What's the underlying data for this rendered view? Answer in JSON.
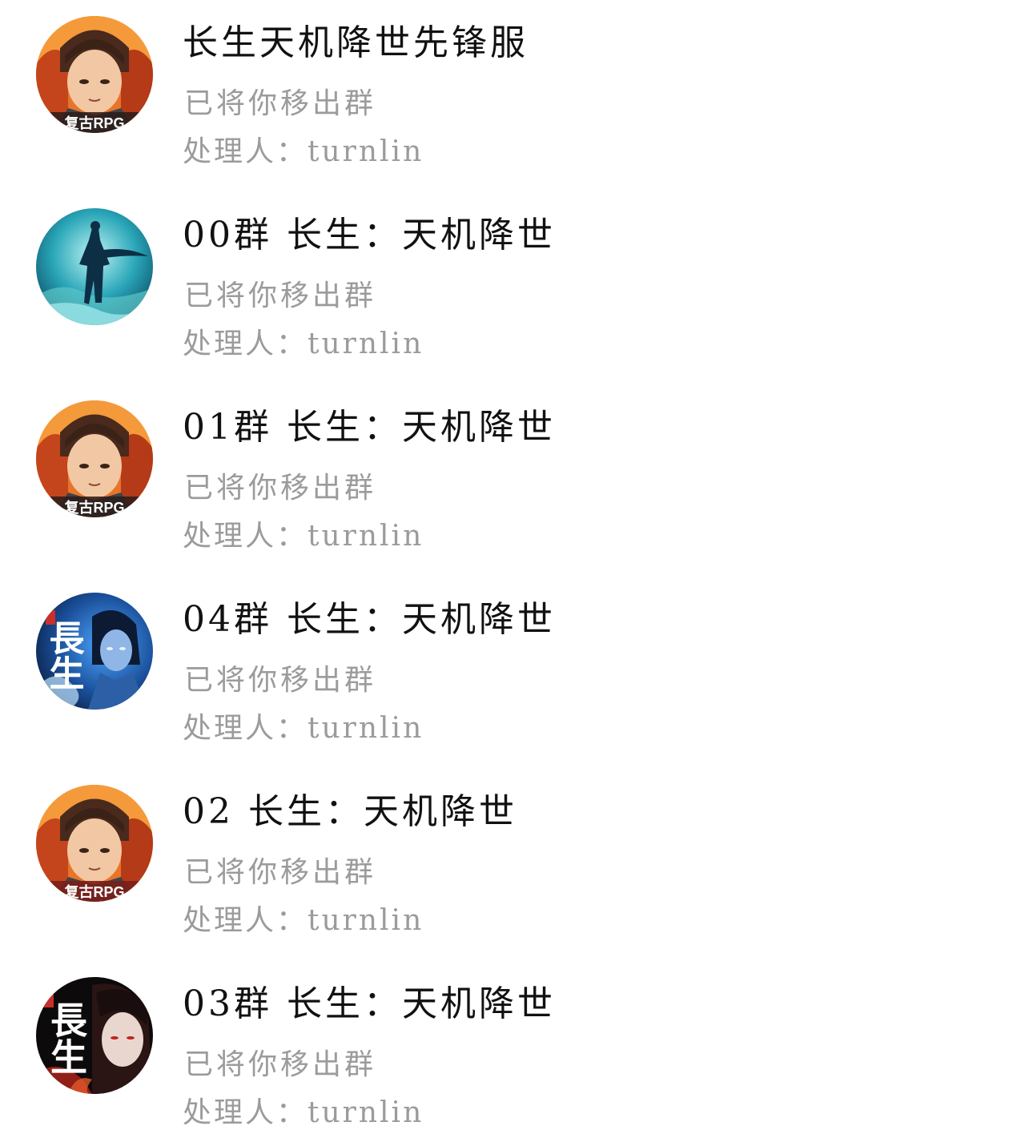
{
  "groups": [
    {
      "avatar_icon": "hero-retro-rpg-avatar",
      "avatar_text": "复古RPG",
      "title": "长生天机降世先锋服",
      "status": "已将你移出群",
      "handler": "处理人：turnlin"
    },
    {
      "avatar_icon": "swordsman-moon-avatar",
      "title": "00群 长生：天机降世",
      "status": "已将你移出群",
      "handler": "处理人：turnlin"
    },
    {
      "avatar_icon": "hero-retro-rpg-avatar",
      "avatar_text": "复古RPG",
      "title": "01群 长生：天机降世",
      "status": "已将你移出群",
      "handler": "处理人：turnlin"
    },
    {
      "avatar_icon": "changsheng-blue-avatar",
      "avatar_text": "長生",
      "title": "04群 长生：天机降世",
      "status": "已将你移出群",
      "handler": "处理人：turnlin"
    },
    {
      "avatar_icon": "hero-retro-rpg-avatar",
      "avatar_text": "复古RPG",
      "title": "02 长生：天机降世",
      "status": "已将你移出群",
      "handler": "处理人：turnlin"
    },
    {
      "avatar_icon": "changsheng-red-avatar",
      "avatar_text": "長生",
      "title": "03群 长生：天机降世",
      "status": "已将你移出群",
      "handler": "处理人：turnlin"
    }
  ]
}
